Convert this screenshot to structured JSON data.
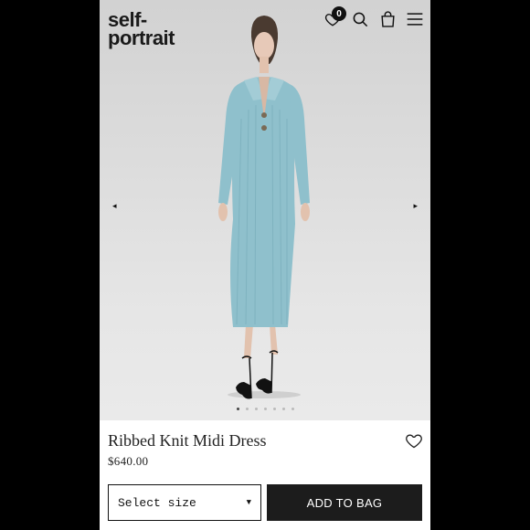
{
  "brand": {
    "logo_line1": "self-",
    "logo_line2": "portrait"
  },
  "header": {
    "wishlist_count": "0"
  },
  "gallery": {
    "prev_glyph": "◂",
    "next_glyph": "▸",
    "dot_count": 7,
    "active_dot": 0
  },
  "product": {
    "name": "Ribbed Knit Midi Dress",
    "price": "$640.00"
  },
  "actions": {
    "size_placeholder": "Select size",
    "size_caret": "▼",
    "add_label": "ADD TO BAG"
  },
  "colors": {
    "dress": "#8fc0cc",
    "button_bg": "#1c1c1c"
  }
}
